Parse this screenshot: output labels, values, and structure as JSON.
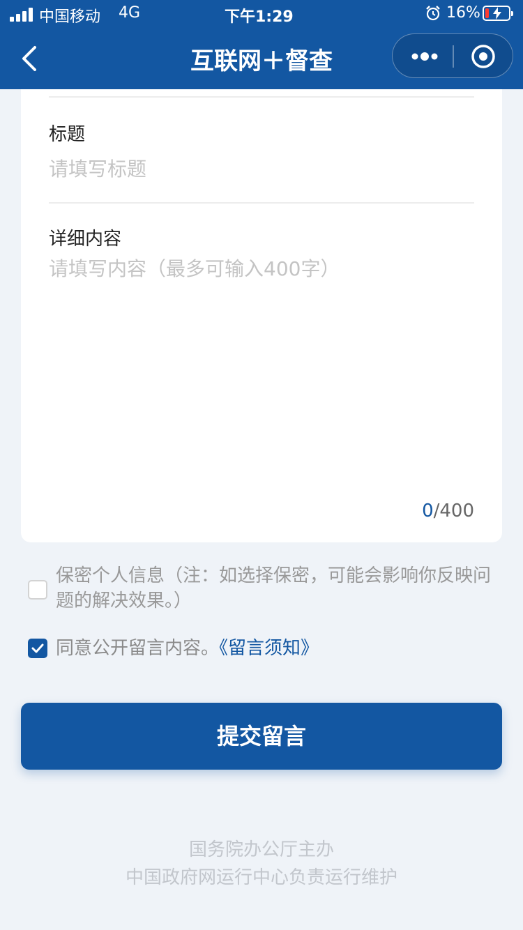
{
  "status_bar": {
    "carrier": "中国移动",
    "network": "4G",
    "time": "下午1:29",
    "battery_percent": "16%",
    "battery_level": 0.16,
    "icons": [
      "signal-icon",
      "alarm-icon",
      "battery-charging-icon"
    ]
  },
  "nav": {
    "title": "互联网＋督查",
    "back_icon": "chevron-left-icon",
    "more_icon": "more-dots-icon",
    "close_icon": "target-circle-icon"
  },
  "form": {
    "title_label": "标题",
    "title_placeholder": "请填写标题",
    "title_value": "",
    "content_label": "详细内容",
    "content_placeholder": "请填写内容（最多可输入400字）",
    "content_value": "",
    "counter_current": "0",
    "counter_max": "/400"
  },
  "options": {
    "confidential": {
      "checked": false,
      "label": "保密个人信息（注：如选择保密，可能会影响你反映问题的解决效果。）"
    },
    "agree_public": {
      "checked": true,
      "label": "同意公开留言内容。",
      "link_label": "《留言须知》"
    }
  },
  "submit_label": "提交留言",
  "footer": {
    "line1": "国务院办公厅主办",
    "line2": "中国政府网运行中心负责运行维护"
  },
  "colors": {
    "primary": "#1357a2",
    "background": "#eff3f8",
    "placeholder": "#c4c4c4",
    "battery_low": "#ff3b30"
  }
}
